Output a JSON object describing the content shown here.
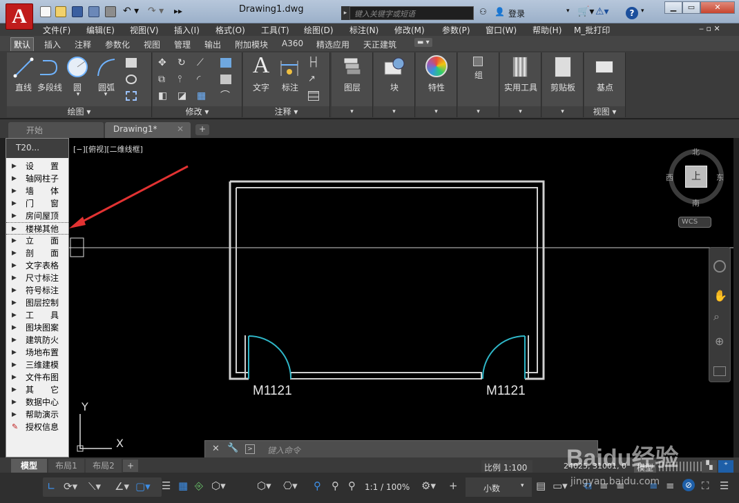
{
  "app": {
    "logo": "A",
    "title": "Drawing1.dwg",
    "search_placeholder": "键入关键字或短语",
    "login": "登录"
  },
  "menu": [
    "文件(F)",
    "编辑(E)",
    "视图(V)",
    "插入(I)",
    "格式(O)",
    "工具(T)",
    "绘图(D)",
    "标注(N)",
    "修改(M)",
    "参数(P)",
    "窗口(W)",
    "帮助(H)",
    "M_批打印"
  ],
  "ribbon_tabs": [
    "默认",
    "插入",
    "注释",
    "参数化",
    "视图",
    "管理",
    "输出",
    "附加模块",
    "A360",
    "精选应用",
    "天正建筑"
  ],
  "ribbon": {
    "draw": {
      "title": "绘图 ▾",
      "tools": [
        "直线",
        "多段线",
        "圆",
        "圆弧"
      ]
    },
    "modify": {
      "title": "修改 ▾"
    },
    "annotate": {
      "title": "注释 ▾",
      "tools": [
        "文字",
        "标注"
      ]
    },
    "layers": "图层",
    "block": "块",
    "properties": "特性",
    "group": "组",
    "utilities": "实用工具",
    "clipboard": "剪贴板",
    "view": {
      "title": "视图 ▾",
      "tool": "基点"
    }
  },
  "file_tabs": {
    "start": "开始",
    "drawing": "Drawing1*"
  },
  "palette": {
    "title": "T20...",
    "items": [
      "设　　置",
      "轴网柱子",
      "墙　　体",
      "门　　窗",
      "房间屋顶",
      "楼梯其他",
      "立　　面",
      "剖　　面",
      "文字表格",
      "尺寸标注",
      "符号标注",
      "图层控制",
      "工　　具",
      "图块图案",
      "建筑防火",
      "场地布置",
      "三维建模",
      "文件布图",
      "其　　它",
      "数据中心",
      "帮助演示",
      "授权信息"
    ],
    "selected": 5
  },
  "viewport": {
    "label": "[−][俯视][二维线框]",
    "door_left": "M1121",
    "door_right": "M1121",
    "ucs_x": "X",
    "ucs_y": "Y"
  },
  "viewcube": {
    "north": "北",
    "south": "南",
    "east": "东",
    "west": "西",
    "top": "上",
    "wcs": "WCS"
  },
  "command": {
    "placeholder": "键入命令"
  },
  "layout_tabs": [
    "模型",
    "布局1",
    "布局2"
  ],
  "status": {
    "scale": "比例 1:100",
    "coords": "24025, 31001, 0",
    "model": "模型",
    "anno_scale": "1:1 / 100%",
    "text_size": "小数"
  },
  "watermark": {
    "brand": "Baidu经验",
    "url": "jingyan.baidu.com"
  },
  "colors": {
    "accent": "#c01c1c",
    "wall": "#d0d0d0",
    "door": "#2fb7c8",
    "arrow": "#e23232"
  }
}
